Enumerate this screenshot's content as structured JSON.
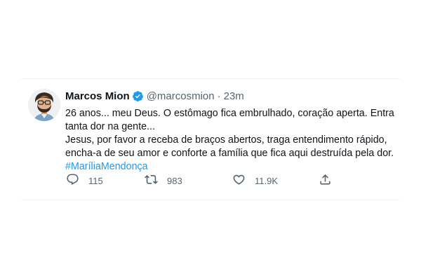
{
  "tweet": {
    "display_name": "Marcos Mion",
    "handle": "@marcosmion",
    "separator": "·",
    "time": "23m",
    "text_lines": [
      "26 anos... meu Deus. O estômago fica embrulhado, coração aperta. Entra",
      "tanta dor na gente...",
      "Jesus, por favor a receba de braços abertos, traga entendimento rápido,",
      "encha-a de seu amor e conforte a família que fica aqui destruída pela dor."
    ],
    "hashtag": "#MaríliaMendonça"
  },
  "actions": {
    "reply_count": "115",
    "retweet_count": "983",
    "like_count": "11.9K"
  },
  "colors": {
    "text": "#0f1419",
    "muted": "#536471",
    "accent": "#1d9bf0",
    "verified": "#1d9bf0"
  },
  "icons": {
    "avatar": "avatar",
    "verified": "verified-badge-icon",
    "reply": "reply-icon",
    "retweet": "retweet-icon",
    "like": "heart-icon",
    "share": "share-icon"
  }
}
